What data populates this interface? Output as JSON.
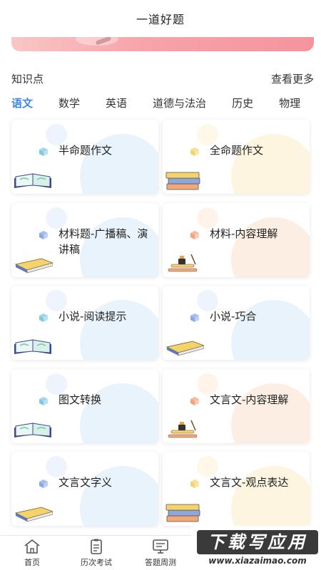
{
  "header": {
    "title": "一道好题"
  },
  "section": {
    "label": "知识点",
    "more": "查看更多"
  },
  "tabs": [
    {
      "label": "语文",
      "active": true
    },
    {
      "label": "数学",
      "active": false
    },
    {
      "label": "英语",
      "active": false
    },
    {
      "label": "道德与法治",
      "active": false
    },
    {
      "label": "历史",
      "active": false
    },
    {
      "label": "物理",
      "active": false
    }
  ],
  "cards": [
    {
      "title": "半命题作文",
      "cube_color": "#7ec8e3",
      "book": "green-open",
      "tint": "blue"
    },
    {
      "title": "全命题作文",
      "cube_color": "#f5d36b",
      "book": "stack",
      "tint": "yellow"
    },
    {
      "title": "材料题-广播稿、演讲稿",
      "cube_color": "#8aa6e8",
      "book": "yellow-flat",
      "tint": "blue"
    },
    {
      "title": "材料-内容理解",
      "cube_color": "#f3a27a",
      "book": "ink",
      "tint": "orange"
    },
    {
      "title": "小说-阅读提示",
      "cube_color": "#7ec8e3",
      "book": "green-open",
      "tint": "blue"
    },
    {
      "title": "小说-巧合",
      "cube_color": "#8aa6e8",
      "book": "yellow-flat",
      "tint": "blue"
    },
    {
      "title": "图文转换",
      "cube_color": "#7ec8e3",
      "book": "green-open",
      "tint": "blue"
    },
    {
      "title": "文言文-内容理解",
      "cube_color": "#f3a27a",
      "book": "ink",
      "tint": "orange"
    },
    {
      "title": "文言文字义",
      "cube_color": "#8aa6e8",
      "book": "yellow-flat",
      "tint": "blue"
    },
    {
      "title": "文言文-观点表达",
      "cube_color": "#f5d36b",
      "book": "stack",
      "tint": "yellow"
    }
  ],
  "nav": [
    {
      "label": "首页",
      "icon": "home-icon"
    },
    {
      "label": "历次考试",
      "icon": "clipboard-icon"
    },
    {
      "label": "答题周测",
      "icon": "monitor-icon"
    }
  ],
  "watermark": {
    "text": "下载写应用",
    "url": "www.xiazaimao.com"
  }
}
